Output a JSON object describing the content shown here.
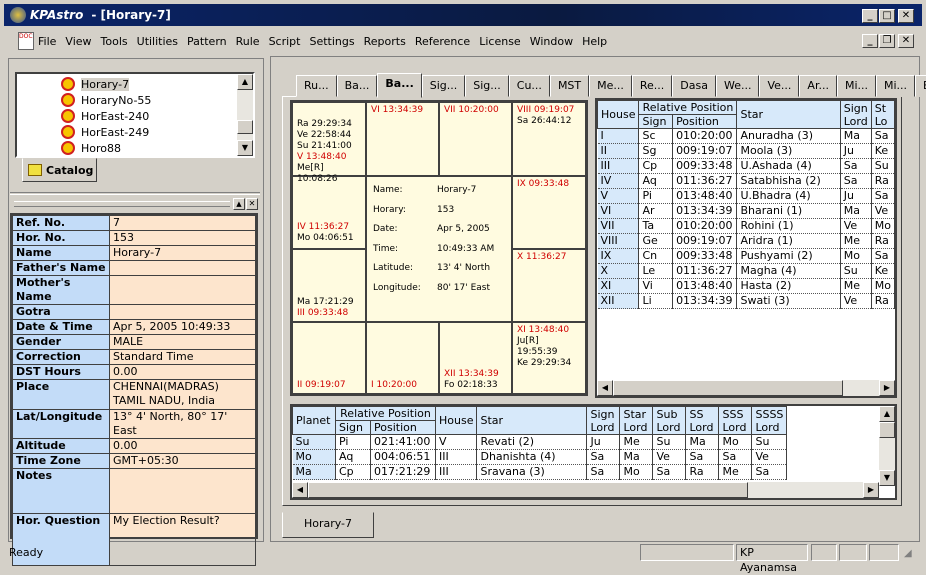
{
  "window": {
    "app_name": "KPAstro",
    "doc_title": "- [Horary-7]"
  },
  "menu": [
    "File",
    "View",
    "Tools",
    "Utilities",
    "Pattern",
    "Rule",
    "Script",
    "Settings",
    "Reports",
    "Reference",
    "License",
    "Window",
    "Help"
  ],
  "catalog": {
    "items": [
      "Horary-7",
      "HoraryNo-55",
      "HorEast-240",
      "HorEast-249",
      "Horo88"
    ],
    "selected": "Horary-7",
    "tab_label": "Catalog"
  },
  "properties": [
    {
      "key": "Ref. No.",
      "value": "7"
    },
    {
      "key": "Hor. No.",
      "value": "153"
    },
    {
      "key": "Name",
      "value": "Horary-7"
    },
    {
      "key": "Father's Name",
      "value": ""
    },
    {
      "key": "Mother's Name",
      "value": ""
    },
    {
      "key": "Gotra",
      "value": ""
    },
    {
      "key": "Date & Time",
      "value": "Apr 5,  2005 10:49:33"
    },
    {
      "key": "Gender",
      "value": "MALE"
    },
    {
      "key": "Correction",
      "value": "Standard Time"
    },
    {
      "key": "DST Hours",
      "value": " 0.00"
    },
    {
      "key": "Place",
      "value": "CHENNAI(MADRAS)\nTAMIL NADU, India"
    },
    {
      "key": "Lat/Longitude",
      "value": "13° 4' North, 80° 17' East"
    },
    {
      "key": "Altitude",
      "value": " 0.00"
    },
    {
      "key": "Time Zone",
      "value": "GMT+05:30"
    },
    {
      "key": "Notes",
      "value": ""
    },
    {
      "key": "Hor. Question",
      "value": "My Election Result?"
    }
  ],
  "tabs": [
    "Ru...",
    "Ba...",
    "Ba...",
    "Sig...",
    "Sig...",
    "Cu...",
    "MST",
    "Me...",
    "Re...",
    "Dasa",
    "We...",
    "Ve...",
    "Ar...",
    "Mi...",
    "Mi...",
    "BAV"
  ],
  "active_tab_index": 2,
  "chart": {
    "c1": [
      "Ra  29:29:34",
      "Ve  22:58:44",
      "Su  21:41:00"
    ],
    "c1_red": "V  13:48:40",
    "c1_last": "Me[R]  10:08:26",
    "c2": "VI  13:34:39",
    "c3": "VII  10:20:00",
    "c4_red": "VIII  09:19:07",
    "c4": "Sa  26:44:12",
    "c5_red": "IV  11:36:27",
    "c5": "Mo  04:06:51",
    "c8_red": "IX  09:33:48",
    "c12_red": "X  11:36:27",
    "c9": "Ma  17:21:29",
    "c9_red": "III  09:33:48",
    "c16_red": "XI  13:48:40",
    "c16": [
      "Ju[R]  19:55:39",
      "Ke  29:29:34"
    ],
    "c13": "II  09:19:07",
    "c14": "I  10:20:00",
    "c15_red": "XII  13:34:39",
    "c15": "Fo  02:18:33",
    "info": [
      [
        "Name:",
        "Horary-7"
      ],
      [
        "Horary:",
        "153"
      ],
      [
        "Date:",
        "Apr 5, 2005"
      ],
      [
        "Time:",
        "10:49:33 AM"
      ],
      [
        "Latitude:",
        "13' 4' North"
      ],
      [
        "Longitude:",
        "80' 17' East"
      ]
    ]
  },
  "house_table": {
    "headers": {
      "house": "House",
      "rel": "Relative Position",
      "sign": "Sign",
      "position": "Position",
      "star": "Star",
      "sign_lord": "Sign Lord",
      "star_lord": "St Lo"
    },
    "rows": [
      [
        "I",
        "Sc",
        "010:20:00",
        "Anuradha (3)",
        "Ma",
        "Sa"
      ],
      [
        "II",
        "Sg",
        "009:19:07",
        "Moola (3)",
        "Ju",
        "Ke"
      ],
      [
        "III",
        "Cp",
        "009:33:48",
        "U.Ashada (4)",
        "Sa",
        "Su"
      ],
      [
        "IV",
        "Aq",
        "011:36:27",
        "Satabhisha (2)",
        "Sa",
        "Ra"
      ],
      [
        "V",
        "Pi",
        "013:48:40",
        "U.Bhadra (4)",
        "Ju",
        "Sa"
      ],
      [
        "VI",
        "Ar",
        "013:34:39",
        "Bharani (1)",
        "Ma",
        "Ve"
      ],
      [
        "VII",
        "Ta",
        "010:20:00",
        "Rohini (1)",
        "Ve",
        "Mo"
      ],
      [
        "VIII",
        "Ge",
        "009:19:07",
        "Aridra (1)",
        "Me",
        "Ra"
      ],
      [
        "IX",
        "Cn",
        "009:33:48",
        "Pushyami (2)",
        "Mo",
        "Sa"
      ],
      [
        "X",
        "Le",
        "011:36:27",
        "Magha (4)",
        "Su",
        "Ke"
      ],
      [
        "XI",
        "Vi",
        "013:48:40",
        "Hasta (2)",
        "Me",
        "Mo"
      ],
      [
        "XII",
        "Li",
        "013:34:39",
        "Swati (3)",
        "Ve",
        "Ra"
      ]
    ]
  },
  "planet_table": {
    "headers": {
      "planet": "Planet",
      "rel": "Relative Position",
      "sign": "Sign",
      "position": "Position",
      "house": "House",
      "star": "Star",
      "sign_lord": "Sign Lord",
      "star_lord": "Star Lord",
      "sub_lord": "Sub Lord",
      "ss_lord": "SS Lord",
      "sss_lord": "SSS Lord",
      "ssss_lord": "SSSS Lord"
    },
    "rows": [
      [
        "Su",
        "Pi",
        "021:41:00",
        "V",
        "Revati (2)",
        "Ju",
        "Me",
        "Su",
        "Ma",
        "Mo",
        "Su"
      ],
      [
        "Mo",
        "Aq",
        "004:06:51",
        "III",
        "Dhanishta (4)",
        "Sa",
        "Ma",
        "Ve",
        "Sa",
        "Sa",
        "Ve"
      ],
      [
        "Ma",
        "Cp",
        "017:21:29",
        "III",
        "Sravana (3)",
        "Sa",
        "Mo",
        "Sa",
        "Ra",
        "Me",
        "Sa"
      ]
    ]
  },
  "doc_tab": "Horary-7",
  "status": {
    "text": "Ready",
    "ayanamsa": "KP Ayanamsa"
  }
}
